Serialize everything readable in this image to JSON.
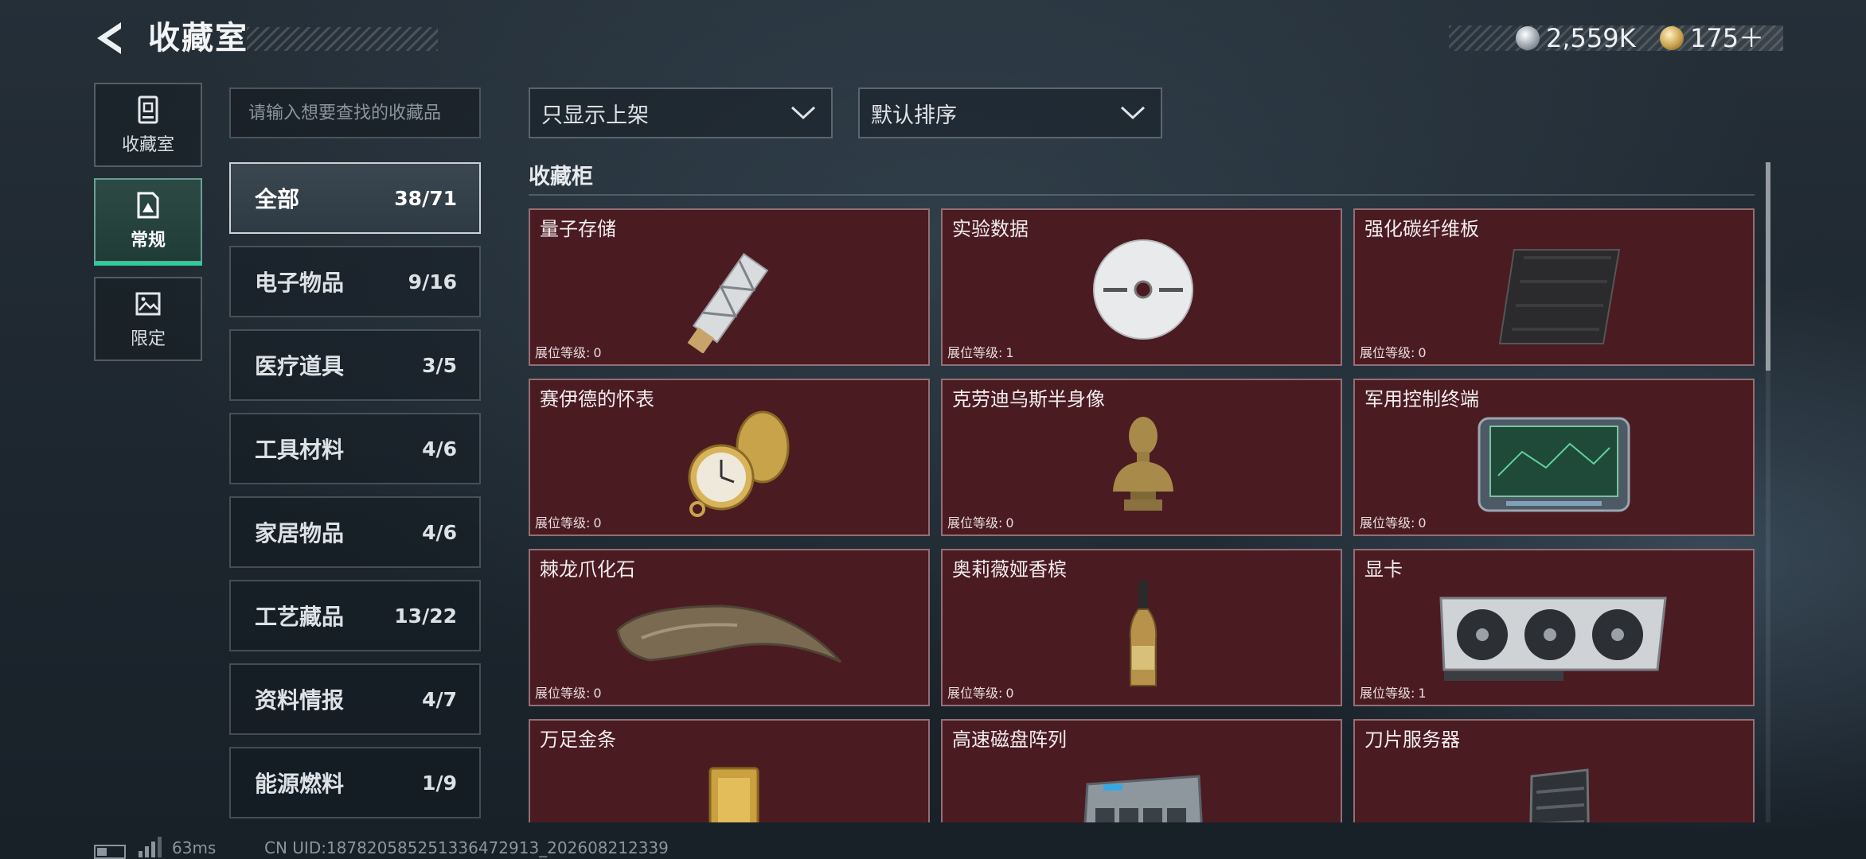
{
  "header": {
    "title": "收藏室",
    "currencies": [
      {
        "icon": "silver-coin-icon",
        "value": "2,559K"
      },
      {
        "icon": "gold-coin-icon",
        "value": "175＋"
      }
    ]
  },
  "nav": {
    "tabs": [
      {
        "label": "收藏室",
        "icon": "cabinet-icon",
        "active": false
      },
      {
        "label": "常规",
        "icon": "image-frame-icon",
        "active": true
      },
      {
        "label": "限定",
        "icon": "landscape-icon",
        "active": false
      }
    ]
  },
  "search": {
    "placeholder": "请输入想要查找的收藏品",
    "value": ""
  },
  "categories": [
    {
      "label": "全部",
      "count": "38/71",
      "active": true
    },
    {
      "label": "电子物品",
      "count": "9/16"
    },
    {
      "label": "医疗道具",
      "count": "3/5"
    },
    {
      "label": "工具材料",
      "count": "4/6"
    },
    {
      "label": "家居物品",
      "count": "4/6"
    },
    {
      "label": "工艺藏品",
      "count": "13/22"
    },
    {
      "label": "资料情报",
      "count": "4/7"
    },
    {
      "label": "能源燃料",
      "count": "1/9"
    }
  ],
  "filters": {
    "display": "只显示上架",
    "sort": "默认排序"
  },
  "cabinet": {
    "title": "收藏柜",
    "level_label": "展位等级:",
    "items": [
      {
        "name": "量子存储",
        "level": "0",
        "art": "usb-drive-icon"
      },
      {
        "name": "实验数据",
        "level": "1",
        "art": "disc-icon"
      },
      {
        "name": "强化碳纤维板",
        "level": "0",
        "art": "carbon-plate-icon"
      },
      {
        "name": "赛伊德的怀表",
        "level": "0",
        "art": "pocket-watch-icon"
      },
      {
        "name": "克劳迪乌斯半身像",
        "level": "0",
        "art": "bust-statue-icon"
      },
      {
        "name": "军用控制终端",
        "level": "0",
        "art": "control-terminal-icon"
      },
      {
        "name": "棘龙爪化石",
        "level": "0",
        "art": "claw-fossil-icon"
      },
      {
        "name": "奥莉薇娅香槟",
        "level": "0",
        "art": "champagne-bottle-icon"
      },
      {
        "name": "显卡",
        "level": "1",
        "art": "graphics-card-icon"
      },
      {
        "name": "万足金条",
        "level": "",
        "art": "gold-bar-icon"
      },
      {
        "name": "高速磁盘阵列",
        "level": "",
        "art": "disk-array-icon"
      },
      {
        "name": "刀片服务器",
        "level": "",
        "art": "blade-server-icon"
      }
    ]
  },
  "status": {
    "ping": "63ms",
    "uid": "CN UID:1878205852513364729​13_202608212339"
  },
  "colors": {
    "card_bg": "#4b1b22",
    "active_nav": "#2ecc9a",
    "background": "#1d262e"
  }
}
